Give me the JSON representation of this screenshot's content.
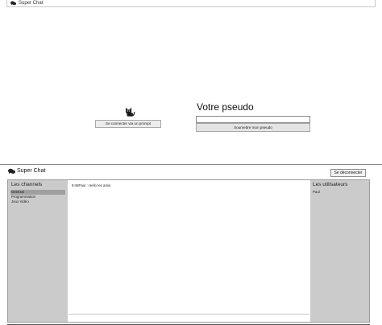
{
  "login_window": {
    "title": "Super Chat",
    "icon": "chat-bubbles-icon",
    "prompt_button_label": "Se connecter via un prompt",
    "pseudo_label": "Votre pseudo",
    "pseudo_input": {
      "value": "",
      "placeholder": ""
    },
    "submit_button_label": "Soumettre mon pseudo",
    "cat_icon": "cat-icon"
  },
  "chat_window": {
    "title": "Super Chat",
    "icon": "chat-bubbles-icon",
    "disconnect_label": "Se déconnecter",
    "channels": {
      "title": "Les channels",
      "items": [
        {
          "label": "Général",
          "selected": true
        },
        {
          "label": "Programmation",
          "selected": false
        },
        {
          "label": "Jeux Vidéo",
          "selected": false
        }
      ]
    },
    "messages": [
      {
        "text": "9:46Paul : Hello les amis"
      }
    ],
    "message_input": {
      "value": "",
      "placeholder": ""
    },
    "users": {
      "title": "Les utilisateurs",
      "items": [
        {
          "label": "Paul"
        }
      ]
    }
  },
  "colors": {
    "panel_bg": "#cbcbcb",
    "selected_bg": "#9f9f9f",
    "border": "#9a9a9a"
  }
}
